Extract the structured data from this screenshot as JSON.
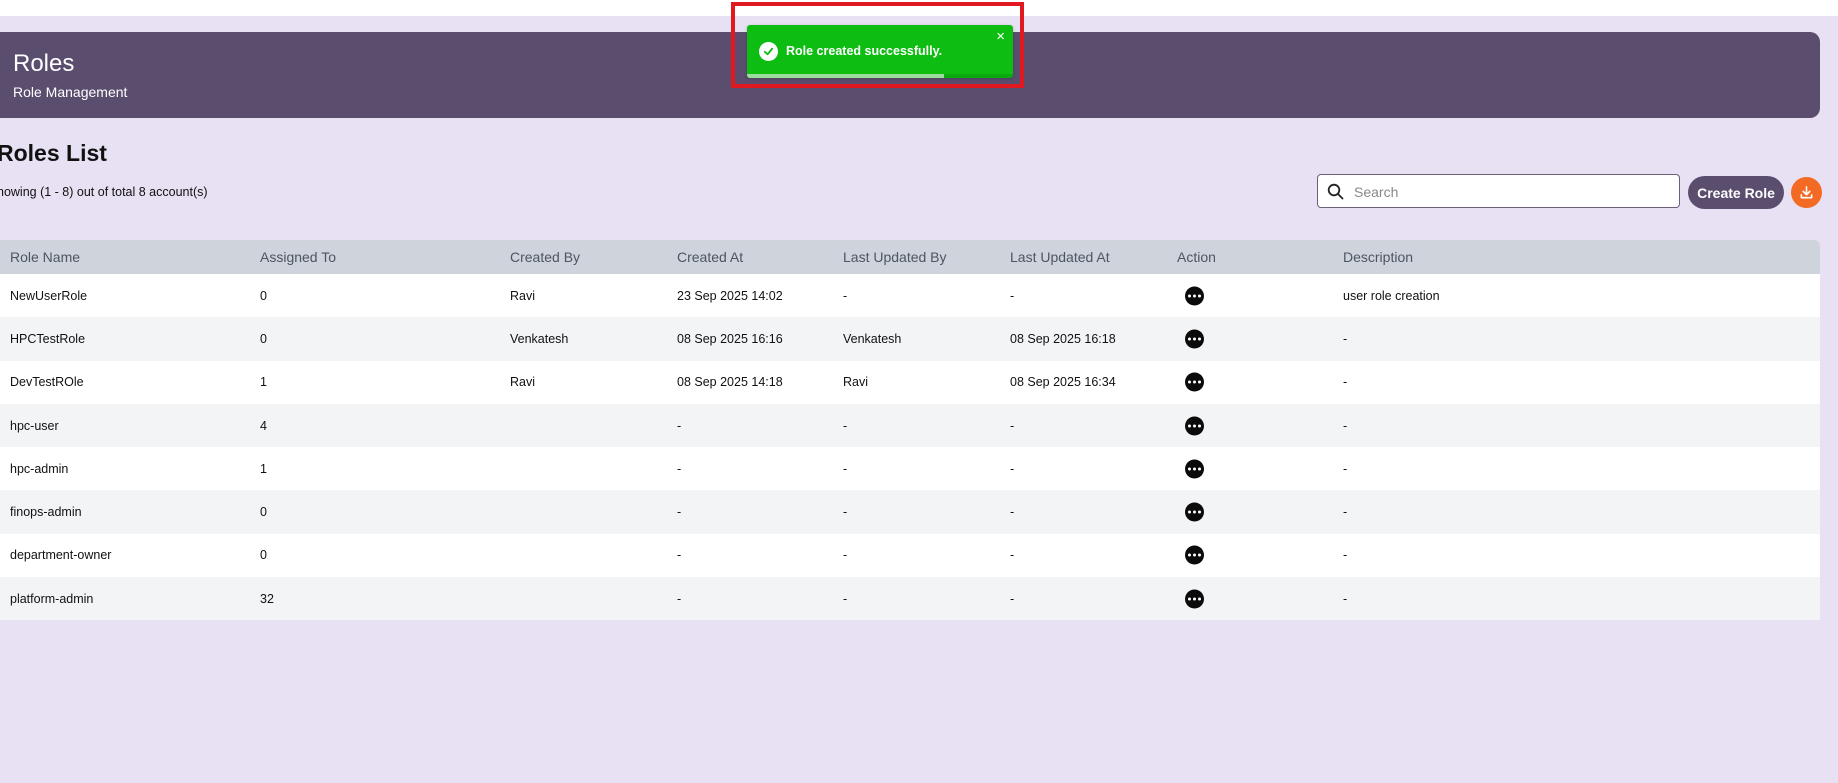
{
  "header": {
    "title": "Roles",
    "subtitle": "Role Management"
  },
  "toast": {
    "message": "Role created successfully.",
    "close": "×",
    "progress": 0.74,
    "color": "#0dbd12"
  },
  "list": {
    "title": "Roles List",
    "count_text": "howing (1 - 8) out of total 8 account(s)"
  },
  "search": {
    "placeholder": "Search",
    "value": ""
  },
  "buttons": {
    "create_role": "Create Role"
  },
  "colors": {
    "accent": "#5b4d6e",
    "download": "#f26a24",
    "background": "#e8e0f3"
  },
  "table": {
    "columns": [
      "Role Name",
      "Assigned To",
      "Created By",
      "Created At",
      "Last Updated By",
      "Last Updated At",
      "Action",
      "Description"
    ],
    "rows": [
      {
        "name": "NewUserRole",
        "assigned": "0",
        "created_by": "Ravi",
        "created_at": "23 Sep 2025 14:02",
        "updated_by": "-",
        "updated_at": "-",
        "description": "user role creation"
      },
      {
        "name": "HPCTestRole",
        "assigned": "0",
        "created_by": "Venkatesh",
        "created_at": "08 Sep 2025 16:16",
        "updated_by": "Venkatesh",
        "updated_at": "08 Sep 2025 16:18",
        "description": "-"
      },
      {
        "name": "DevTestROle",
        "assigned": "1",
        "created_by": "Ravi",
        "created_at": "08 Sep 2025 14:18",
        "updated_by": "Ravi",
        "updated_at": "08 Sep 2025 16:34",
        "description": "-"
      },
      {
        "name": "hpc-user",
        "assigned": "4",
        "created_by": "",
        "created_at": "-",
        "updated_by": "-",
        "updated_at": "-",
        "description": "-"
      },
      {
        "name": "hpc-admin",
        "assigned": "1",
        "created_by": "",
        "created_at": "-",
        "updated_by": "-",
        "updated_at": "-",
        "description": "-"
      },
      {
        "name": "finops-admin",
        "assigned": "0",
        "created_by": "",
        "created_at": "-",
        "updated_by": "-",
        "updated_at": "-",
        "description": "-"
      },
      {
        "name": "department-owner",
        "assigned": "0",
        "created_by": "",
        "created_at": "-",
        "updated_by": "-",
        "updated_at": "-",
        "description": "-"
      },
      {
        "name": "platform-admin",
        "assigned": "32",
        "created_by": "",
        "created_at": "-",
        "updated_by": "-",
        "updated_at": "-",
        "description": "-"
      }
    ]
  }
}
